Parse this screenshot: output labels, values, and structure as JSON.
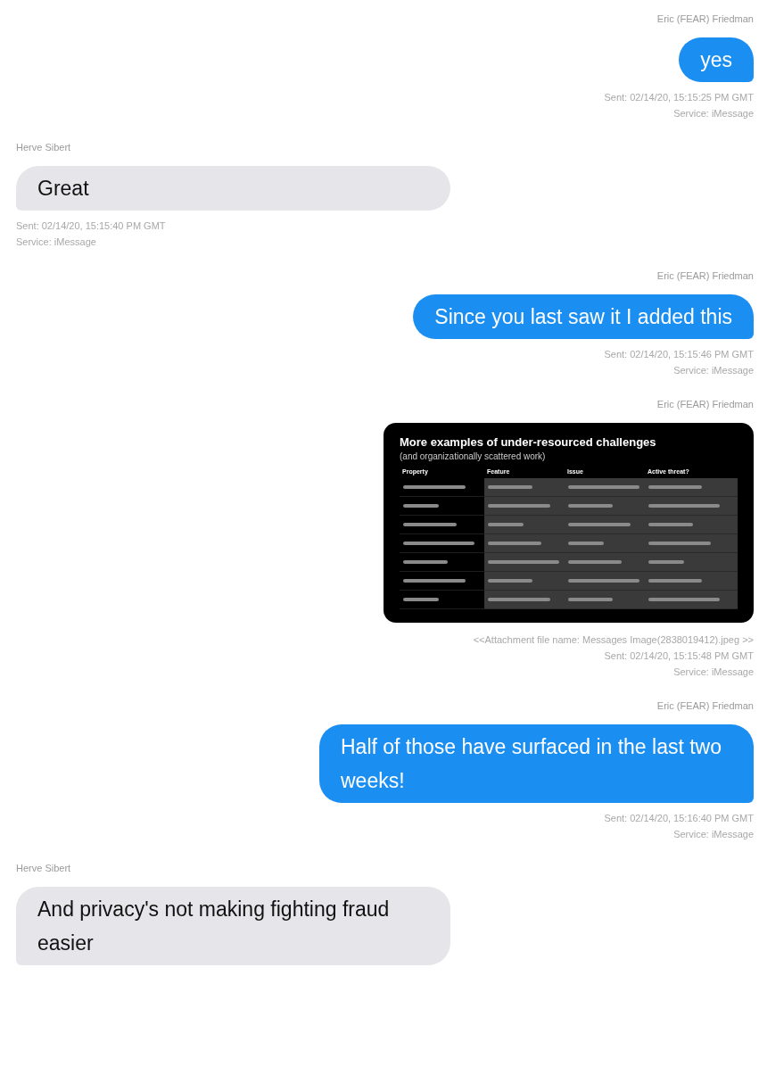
{
  "messages": [
    {
      "kind": "text",
      "outgoing": true,
      "sender": "Eric (FEAR) Friedman",
      "text": "yes",
      "sent": "Sent: 02/14/20, 15:15:25 PM GMT",
      "service": "Service: iMessage"
    },
    {
      "kind": "text",
      "outgoing": false,
      "sender": "Herve Sibert",
      "text": "Great",
      "sent": "Sent: 02/14/20, 15:15:40 PM GMT",
      "service": "Service: iMessage"
    },
    {
      "kind": "text",
      "outgoing": true,
      "sender": "Eric (FEAR) Friedman",
      "text": "Since you last saw it I added this",
      "sent": "Sent: 02/14/20, 15:15:46 PM GMT",
      "service": "Service: iMessage"
    },
    {
      "kind": "image",
      "outgoing": true,
      "sender": "Eric (FEAR) Friedman",
      "image": {
        "title": "More examples of under-resourced challenges",
        "subtitle": "(and organizationally scattered work)",
        "columns": [
          "Property",
          "Feature",
          "Issue",
          "Active threat?"
        ]
      },
      "attachment": "<<Attachment file name: Messages Image(2838019412).jpeg >>",
      "sent": "Sent: 02/14/20, 15:15:48 PM GMT",
      "service": "Service: iMessage"
    },
    {
      "kind": "text",
      "outgoing": true,
      "sender": "Eric (FEAR) Friedman",
      "text": "Half of those have surfaced in the last two weeks!",
      "sent": "Sent: 02/14/20, 15:16:40 PM GMT",
      "service": "Service: iMessage"
    },
    {
      "kind": "text",
      "outgoing": false,
      "sender": "Herve Sibert",
      "text": "And privacy's not making fighting fraud easier"
    }
  ]
}
